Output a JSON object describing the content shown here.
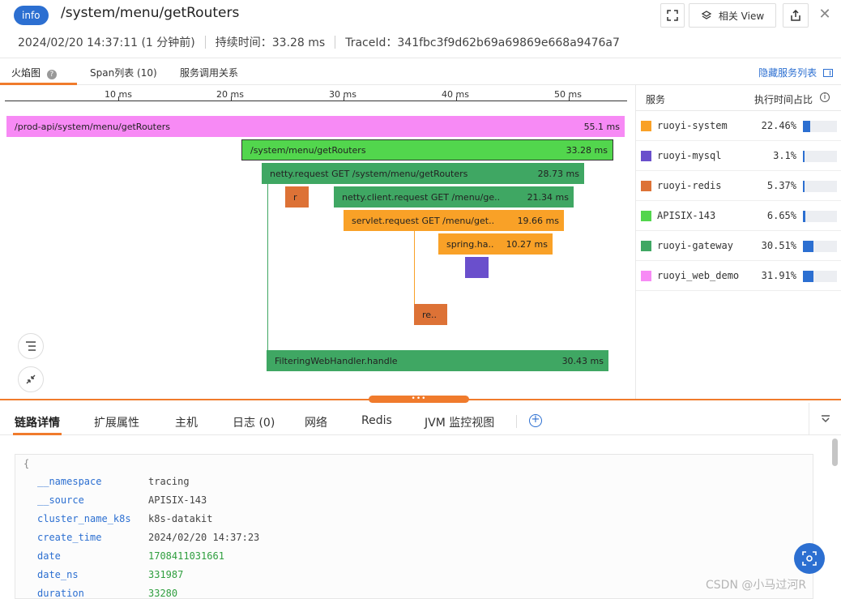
{
  "header": {
    "badge": "info",
    "title": "/system/menu/getRouters",
    "time": "2024/02/20 14:37:11 (1 分钟前)",
    "duration": "持续时间：33.28 ms",
    "trace": "TraceId：341fbc3f9d62b69a69869e668a9476a7",
    "related_view_label": "相关 View"
  },
  "top_tabs": {
    "flame": "火焰图",
    "spans": "Span列表 (10)",
    "relations": "服务调用关系",
    "hide_services": "隐藏服务列表"
  },
  "axis": {
    "ticks": [
      "10 ms",
      "20 ms",
      "30 ms",
      "40 ms",
      "50 ms"
    ]
  },
  "spans": [
    {
      "label": "/prod-api/system/menu/getRouters",
      "duration": "55.1 ms",
      "color": "#f78af5"
    },
    {
      "label": "/system/menu/getRouters",
      "duration": "33.28 ms",
      "color": "#52d64d"
    },
    {
      "label": "netty.request GET /system/menu/getRouters",
      "duration": "28.73 ms",
      "color": "#3fa763"
    },
    {
      "label": "r",
      "duration": "",
      "color": "#dd7236"
    },
    {
      "label": "netty.client.request GET /menu/ge..",
      "duration": "21.34 ms",
      "color": "#3fa763"
    },
    {
      "label": "servlet.request GET /menu/get..",
      "duration": "19.66 ms",
      "color": "#f9a127"
    },
    {
      "label": "spring.ha..",
      "duration": "10.27 ms",
      "color": "#f9a127"
    },
    {
      "label": "",
      "duration": "",
      "color": "#6a4fcc"
    },
    {
      "label": "re..",
      "duration": "",
      "color": "#dd7236"
    },
    {
      "label": "FilteringWebHandler.handle",
      "duration": "30.43 ms",
      "color": "#3fa763"
    }
  ],
  "services_panel": {
    "header_service": "服务",
    "header_ratio": "执行时间占比",
    "items": [
      {
        "name": "ruoyi-system",
        "pct": "22.46%",
        "ratio": 0.2246,
        "color": "#f9a127"
      },
      {
        "name": "ruoyi-mysql",
        "pct": "3.1%",
        "ratio": 0.031,
        "color": "#6a4fcc"
      },
      {
        "name": "ruoyi-redis",
        "pct": "5.37%",
        "ratio": 0.0537,
        "color": "#dd7236"
      },
      {
        "name": "APISIX-143",
        "pct": "6.65%",
        "ratio": 0.0665,
        "color": "#52d64d"
      },
      {
        "name": "ruoyi-gateway",
        "pct": "30.51%",
        "ratio": 0.3051,
        "color": "#3fa763"
      },
      {
        "name": "ruoyi_web_demo",
        "pct": "31.91%",
        "ratio": 0.3191,
        "color": "#f78af5"
      }
    ]
  },
  "handle_dots": "•••",
  "bottom_tabs": [
    "链路详情",
    "扩展属性",
    "主机",
    "日志 (0)",
    "网络",
    "Redis",
    "JVM 监控视图"
  ],
  "detail": {
    "open_brace": "{",
    "fields": [
      {
        "key": "__namespace",
        "value": "tracing",
        "numeric": false
      },
      {
        "key": "__source",
        "value": "APISIX-143",
        "numeric": false
      },
      {
        "key": "cluster_name_k8s",
        "value": "k8s-datakit",
        "numeric": false
      },
      {
        "key": "create_time",
        "value": "2024/02/20 14:37:23",
        "numeric": false
      },
      {
        "key": "date",
        "value": "1708411031661",
        "numeric": true
      },
      {
        "key": "date_ns",
        "value": "331987",
        "numeric": true
      },
      {
        "key": "duration",
        "value": "33280",
        "numeric": true
      }
    ]
  },
  "watermark": "CSDN @小马过河R"
}
